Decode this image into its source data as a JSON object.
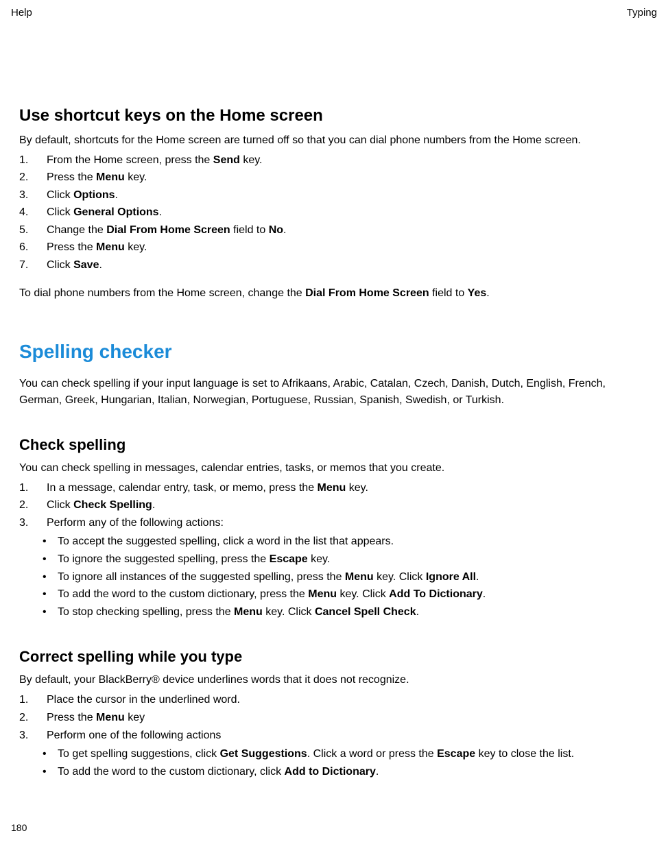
{
  "header": {
    "left": "Help",
    "right": "Typing"
  },
  "page_number": "180",
  "sec1": {
    "title": "Use shortcut keys on the Home screen",
    "intro": "By default, shortcuts for the Home screen are turned off so that you can dial phone numbers from the Home screen.",
    "steps": {
      "s1a": "From the Home screen, press the ",
      "s1b": "Send",
      "s1c": " key.",
      "s2a": "Press the ",
      "s2b": "Menu",
      "s2c": " key.",
      "s3a": "Click ",
      "s3b": "Options",
      "s3c": ".",
      "s4a": "Click ",
      "s4b": "General Options",
      "s4c": ".",
      "s5a": "Change the ",
      "s5b": "Dial From Home Screen",
      "s5c": " field to ",
      "s5d": "No",
      "s5e": ".",
      "s6a": "Press the ",
      "s6b": "Menu",
      "s6c": " key.",
      "s7a": "Click ",
      "s7b": "Save",
      "s7c": "."
    },
    "note_a": "To dial phone numbers from the Home screen, change the ",
    "note_b": "Dial From Home Screen",
    "note_c": " field to ",
    "note_d": "Yes",
    "note_e": "."
  },
  "sec2": {
    "title": "Spelling checker",
    "intro": "You can check spelling if your input language is set to Afrikaans, Arabic, Catalan, Czech, Danish, Dutch, English, French, German, Greek, Hungarian, Italian, Norwegian, Portuguese, Russian, Spanish, Swedish, or Turkish."
  },
  "sec3": {
    "title": "Check spelling",
    "intro": "You can check spelling in messages, calendar entries, tasks, or memos that you create.",
    "steps": {
      "s1a": "In a message, calendar entry, task, or memo, press the ",
      "s1b": "Menu",
      "s1c": " key.",
      "s2a": "Click ",
      "s2b": "Check Spelling",
      "s2c": ".",
      "s3": "Perform any of the following actions:"
    },
    "bullets": {
      "b1": "To accept the suggested spelling, click a word in the list that appears.",
      "b2a": "To ignore the suggested spelling, press the ",
      "b2b": "Escape",
      "b2c": " key.",
      "b3a": "To ignore all instances of the suggested spelling, press the ",
      "b3b": "Menu",
      "b3c": " key. Click ",
      "b3d": "Ignore All",
      "b3e": ".",
      "b4a": "To add the word to the custom dictionary, press the ",
      "b4b": "Menu",
      "b4c": " key. Click ",
      "b4d": "Add To Dictionary",
      "b4e": ".",
      "b5a": "To stop checking spelling, press the ",
      "b5b": "Menu",
      "b5c": " key. Click ",
      "b5d": "Cancel Spell Check",
      "b5e": "."
    }
  },
  "sec4": {
    "title": "Correct spelling while you type",
    "intro": "By default, your BlackBerry® device underlines words that it does not recognize.",
    "steps": {
      "s1": "Place the cursor in the underlined word.",
      "s2a": "Press the ",
      "s2b": "Menu",
      "s2c": " key",
      "s3": "Perform one of the following actions"
    },
    "bullets": {
      "b1a": "To get spelling suggestions, click ",
      "b1b": "Get Suggestions",
      "b1c": ". Click a word or press the ",
      "b1d": "Escape",
      "b1e": " key to close the list.",
      "b2a": "To add the word to the custom dictionary, click ",
      "b2b": "Add to Dictionary",
      "b2c": "."
    }
  }
}
